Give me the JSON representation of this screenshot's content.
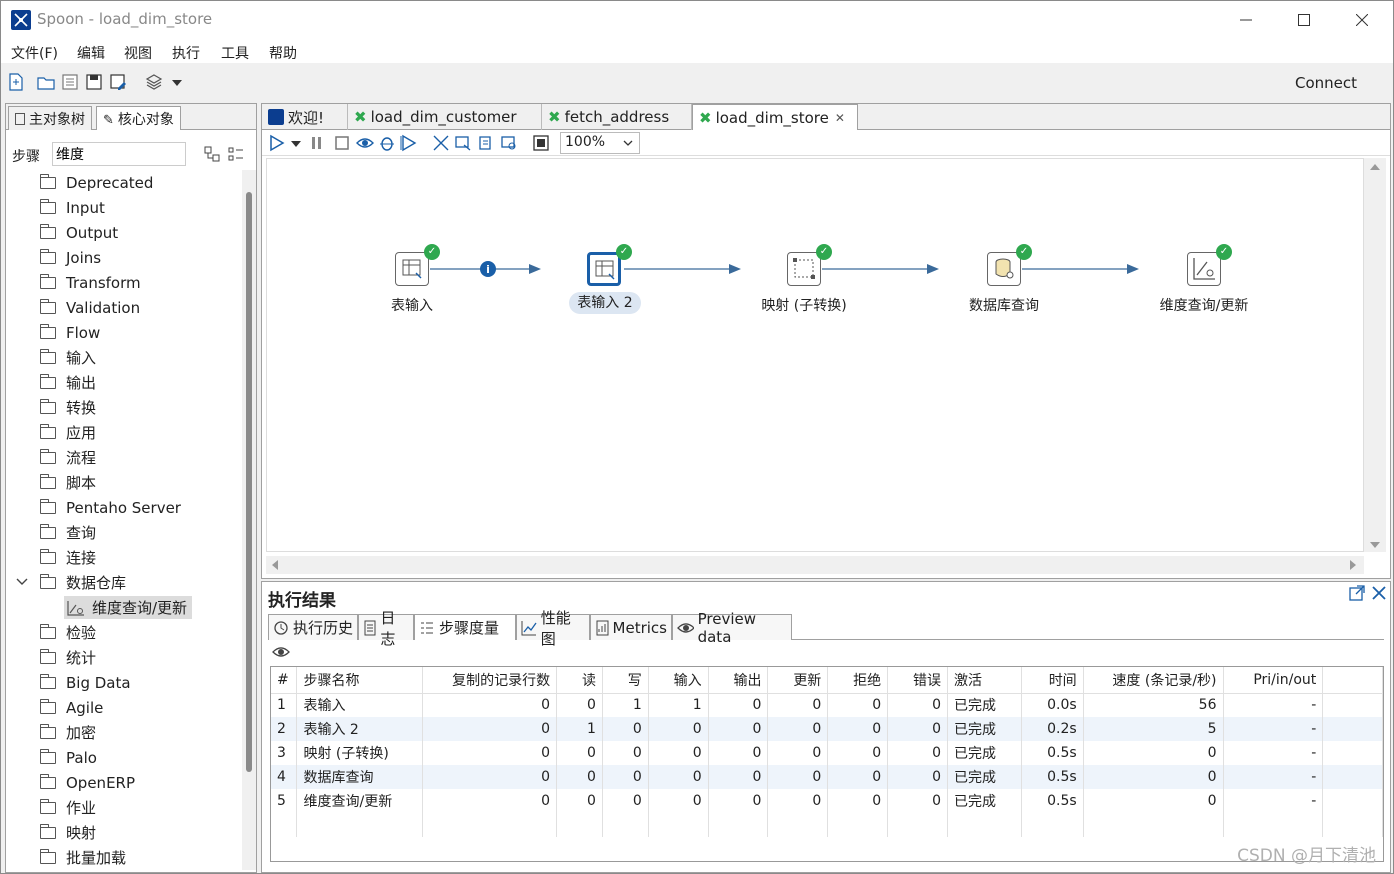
{
  "window": {
    "title": "Spoon - load_dim_store"
  },
  "menu": [
    "文件(F)",
    "编辑",
    "视图",
    "执行",
    "工具",
    "帮助"
  ],
  "toolbar": {
    "connect_label": "Connect"
  },
  "left": {
    "tabs": [
      "主对象树",
      "核心对象"
    ],
    "search_label": "步骤",
    "search_value": "维度",
    "tree": [
      "Deprecated",
      "Input",
      "Output",
      "Joins",
      "Transform",
      "Validation",
      "Flow",
      "输入",
      "输出",
      "转换",
      "应用",
      "流程",
      "脚本",
      "Pentaho Server",
      "查询",
      "连接",
      "数据仓库",
      "维度查询/更新",
      "检验",
      "统计",
      "Big Data",
      "Agile",
      "加密",
      "Palo",
      "OpenERP",
      "作业",
      "映射",
      "批量加载"
    ]
  },
  "filetabs": [
    "欢迎!",
    "load_dim_customer",
    "fetch_address",
    "load_dim_store"
  ],
  "zoom": "100%",
  "steps": [
    "表输入",
    "表输入 2",
    "映射 (子转换)",
    "数据库查询",
    "维度查询/更新"
  ],
  "exec": {
    "title": "执行结果",
    "tabs": [
      "执行历史",
      "日志",
      "步骤度量",
      "性能图",
      "Metrics",
      "Preview data"
    ],
    "columns": [
      "#",
      "步骤名称",
      "复制的记录行数",
      "读",
      "写",
      "输入",
      "输出",
      "更新",
      "拒绝",
      "错误",
      "激活",
      "时间",
      "速度 (条记录/秒)",
      "Pri/in/out"
    ],
    "rows": [
      [
        "1",
        "表输入",
        "0",
        "0",
        "1",
        "1",
        "0",
        "0",
        "0",
        "0",
        "已完成",
        "0.0s",
        "56",
        "-"
      ],
      [
        "2",
        "表输入 2",
        "0",
        "1",
        "0",
        "0",
        "0",
        "0",
        "0",
        "0",
        "已完成",
        "0.2s",
        "5",
        "-"
      ],
      [
        "3",
        "映射 (子转换)",
        "0",
        "0",
        "0",
        "0",
        "0",
        "0",
        "0",
        "0",
        "已完成",
        "0.5s",
        "0",
        "-"
      ],
      [
        "4",
        "数据库查询",
        "0",
        "0",
        "0",
        "0",
        "0",
        "0",
        "0",
        "0",
        "已完成",
        "0.5s",
        "0",
        "-"
      ],
      [
        "5",
        "维度查询/更新",
        "0",
        "0",
        "0",
        "0",
        "0",
        "0",
        "0",
        "0",
        "已完成",
        "0.5s",
        "0",
        "-"
      ]
    ]
  },
  "watermark": "CSDN @月下清池"
}
